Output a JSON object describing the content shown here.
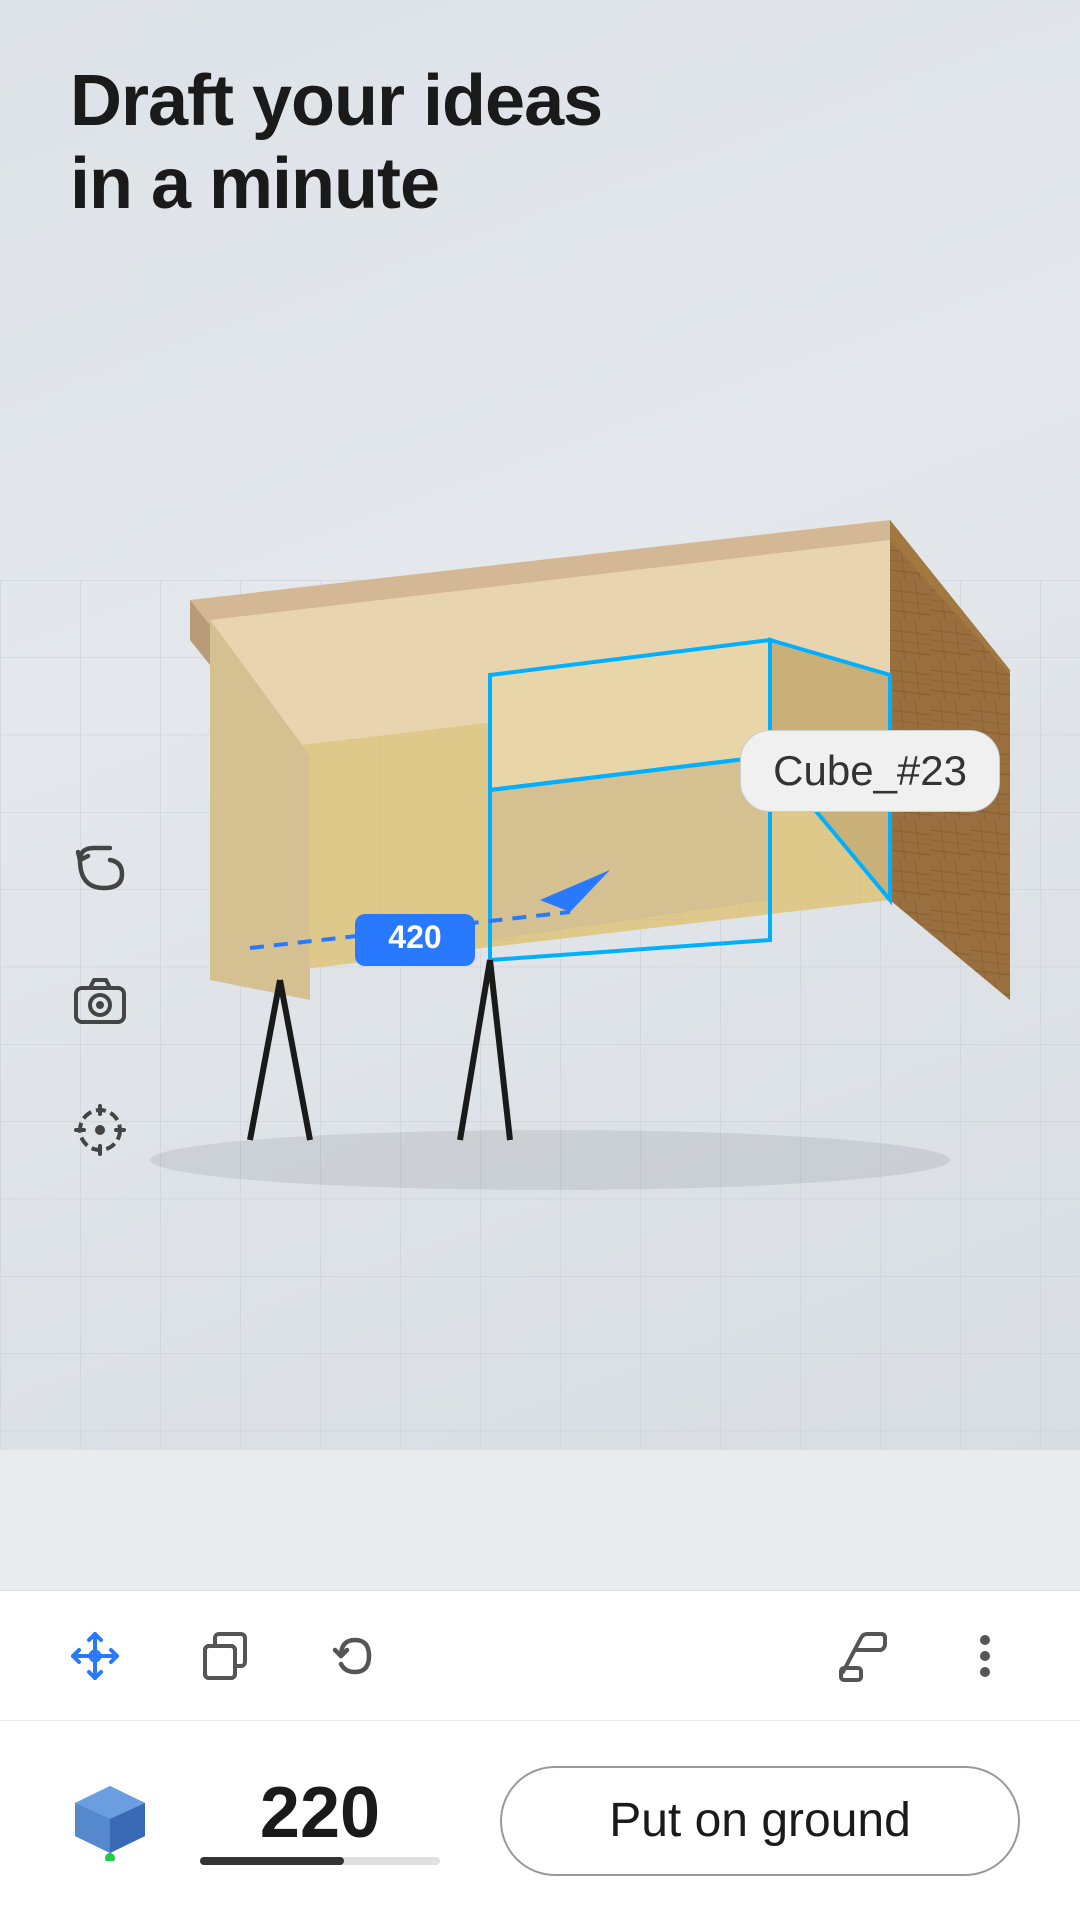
{
  "header": {
    "title_line1": "Draft your ideas",
    "title_line2": "in a minute"
  },
  "scene": {
    "object_label": "Cube_#23",
    "measurement_value": "420",
    "height_value": "220"
  },
  "sidebar": {
    "undo_icon": "undo-icon",
    "camera_icon": "camera-icon",
    "target_icon": "target-icon"
  },
  "toolbar": {
    "move_icon": "move-icon",
    "copy_icon": "copy-icon",
    "reset_icon": "reset-icon",
    "paint_icon": "paint-icon",
    "more_icon": "more-icon"
  },
  "bottom_bar": {
    "put_on_ground_label": "Put on ground",
    "height_label": "220",
    "height_bar_percent": 60
  }
}
